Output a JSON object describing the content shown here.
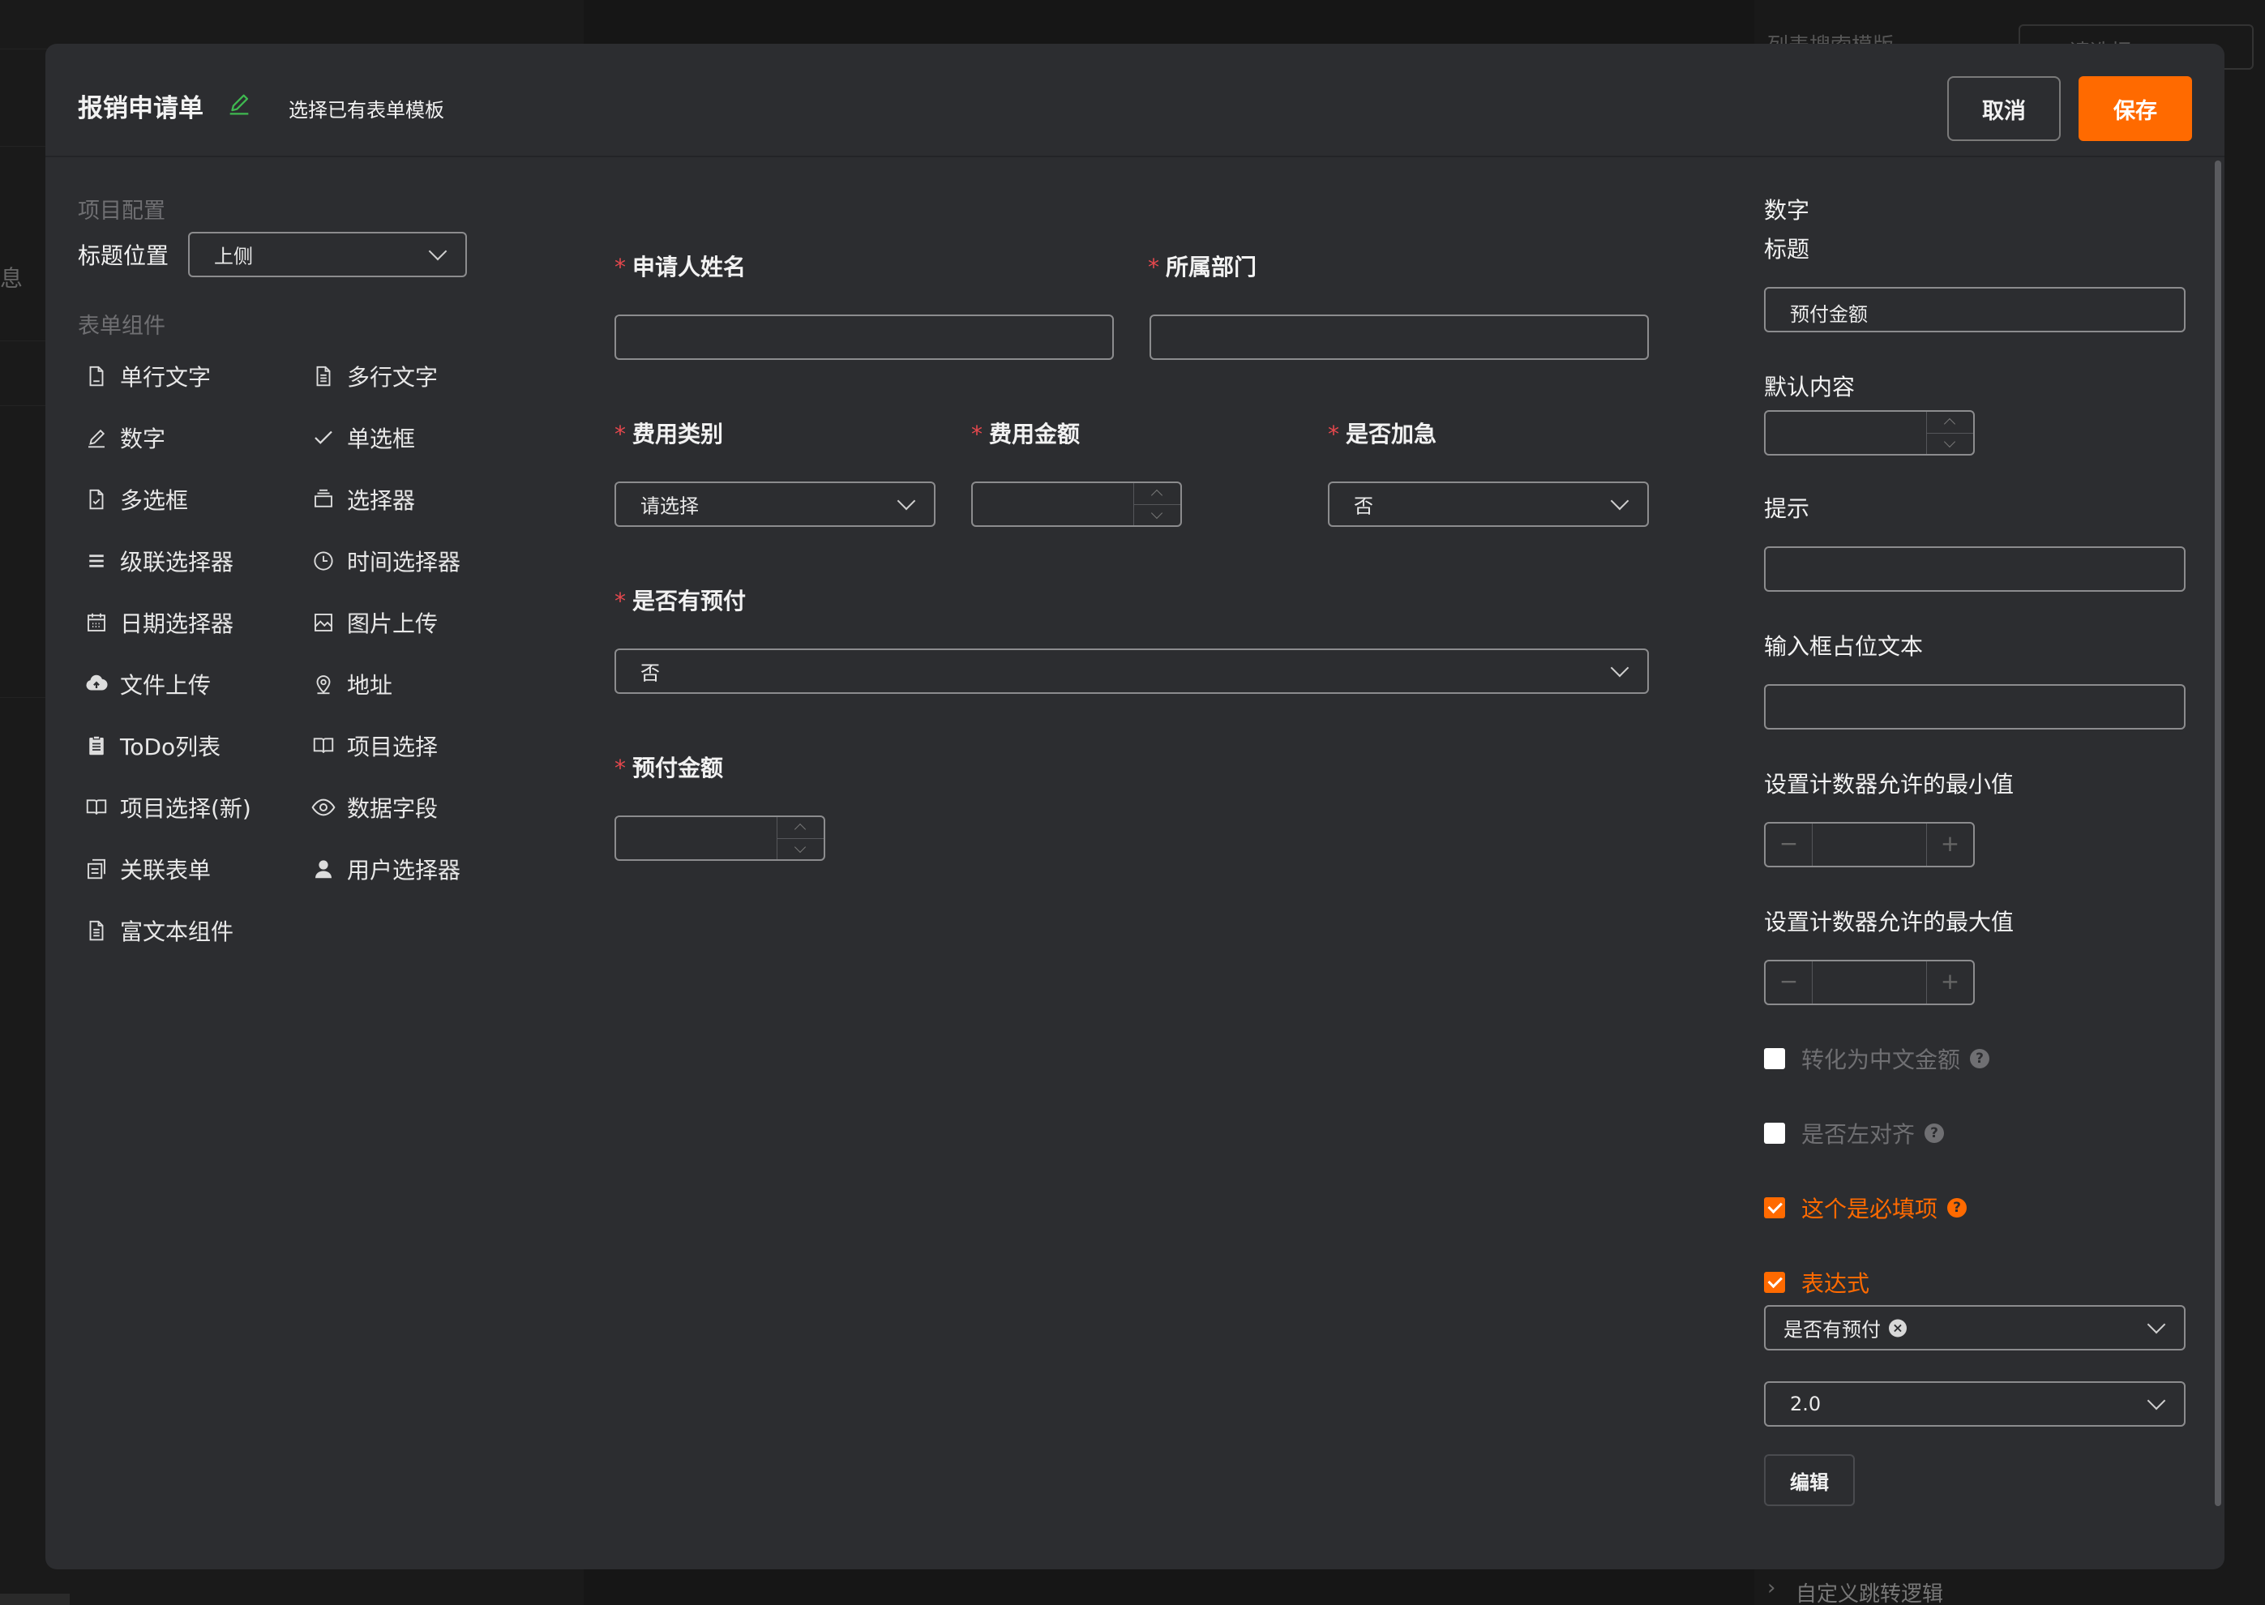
{
  "background": {
    "left_char": "息",
    "right_label": "列表搜索模版",
    "right_select": "请选择",
    "bottom_link": "自定义跳转逻辑"
  },
  "header": {
    "title": "报销申请单",
    "template_link": "选择已有表单模板",
    "cancel_label": "取消",
    "save_label": "保存"
  },
  "left_panel": {
    "config_section": "项目配置",
    "title_position_label": "标题位置",
    "title_position_value": "上侧",
    "components_section": "表单组件",
    "components": [
      {
        "label": "单行文字",
        "icon": "document-icon"
      },
      {
        "label": "多行文字",
        "icon": "document-lines-icon"
      },
      {
        "label": "数字",
        "icon": "pen-icon"
      },
      {
        "label": "单选框",
        "icon": "check-icon"
      },
      {
        "label": "多选框",
        "icon": "doc-check-icon"
      },
      {
        "label": "选择器",
        "icon": "tray-icon"
      },
      {
        "label": "级联选择器",
        "icon": "list-icon"
      },
      {
        "label": "时间选择器",
        "icon": "clock-icon"
      },
      {
        "label": "日期选择器",
        "icon": "calendar-icon"
      },
      {
        "label": "图片上传",
        "icon": "image-icon"
      },
      {
        "label": "文件上传",
        "icon": "cloud-upload-icon"
      },
      {
        "label": "地址",
        "icon": "location-icon"
      },
      {
        "label": "ToDo列表",
        "icon": "clipboard-icon"
      },
      {
        "label": "项目选择",
        "icon": "book-icon"
      },
      {
        "label": "项目选择(新)",
        "icon": "book-icon"
      },
      {
        "label": "数据字段",
        "icon": "eye-icon"
      },
      {
        "label": "关联表单",
        "icon": "copy-icon"
      },
      {
        "label": "用户选择器",
        "icon": "user-icon"
      },
      {
        "label": "富文本组件",
        "icon": "document-lines-icon"
      }
    ]
  },
  "form": {
    "applicant_label": "申请人姓名",
    "department_label": "所属部门",
    "expense_type_label": "费用类别",
    "expense_type_placeholder": "请选择",
    "expense_amount_label": "费用金额",
    "urgent_label": "是否加急",
    "urgent_value": "否",
    "has_prepay_label": "是否有预付",
    "has_prepay_value": "否",
    "prepay_amount_label": "预付金额",
    "required_mark": "*"
  },
  "right_panel": {
    "type_label": "数字",
    "title_label": "标题",
    "title_value": "预付金额",
    "default_label": "默认内容",
    "hint_label": "提示",
    "placeholder_label": "输入框占位文本",
    "min_label": "设置计数器允许的最小值",
    "max_label": "设置计数器允许的最大值",
    "minus": "−",
    "plus": "+",
    "chinese_amount_label": "转化为中文金额",
    "left_align_label": "是否左对齐",
    "required_label": "这个是必填项",
    "expression_label": "表达式",
    "expression_tag": "是否有预付",
    "version_value": "2.0",
    "edit_label": "编辑",
    "help_glyph": "?",
    "tag_close": "×"
  },
  "colors": {
    "accent": "#ff6a00",
    "required": "#e5484d",
    "edit_icon": "#3fb950"
  }
}
